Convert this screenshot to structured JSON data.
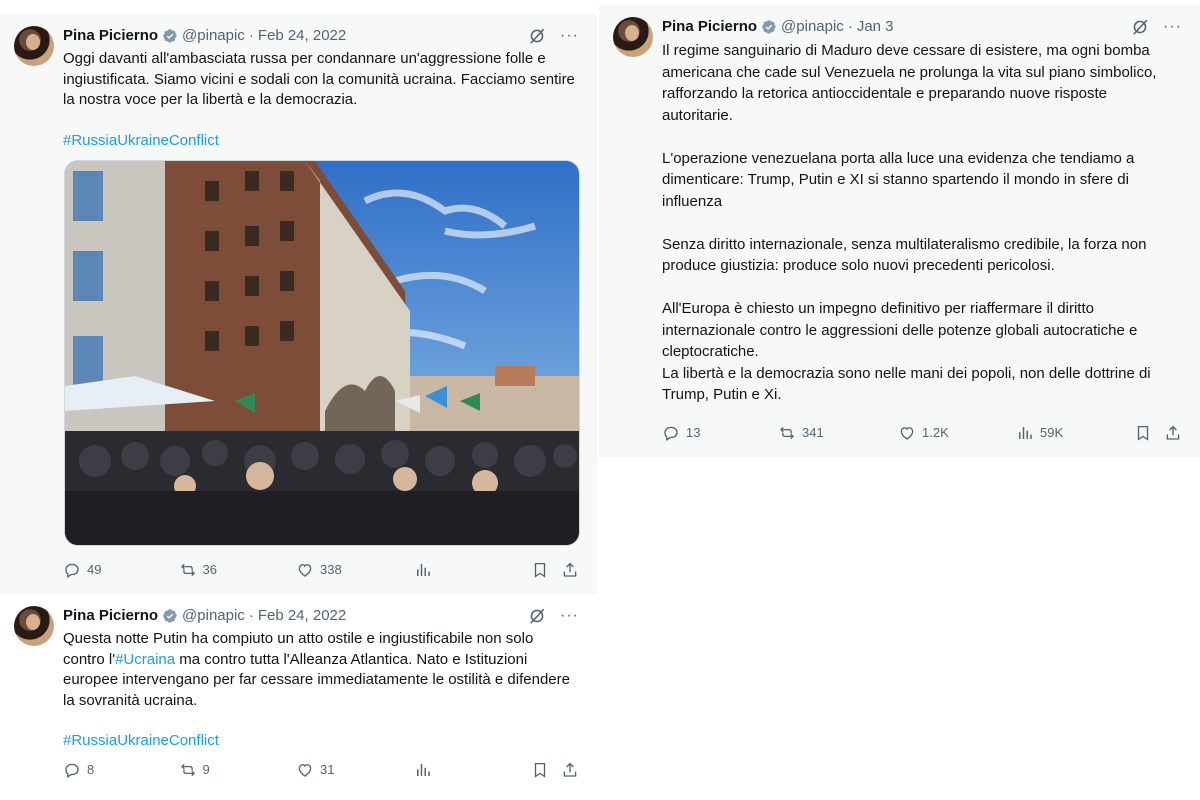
{
  "tweets": [
    {
      "name": "Pina Picierno",
      "handle": "@pinapic",
      "date": "Feb 24, 2022",
      "text": "Oggi davanti all'ambasciata russa per condannare un'aggressione folle e ingiustificata. Siamo vicini e sodali con la comunità ucraina. Facciamo sentire la nostra voce per la libertà e la democrazia.",
      "hashtag": "#RussiaUkraineConflict",
      "replies": "49",
      "reposts": "36",
      "likes": "338",
      "views": ""
    },
    {
      "name": "Pina Picierno",
      "handle": "@pinapic",
      "date": "Feb 24, 2022",
      "text_before": "Questa notte Putin ha compiuto un atto ostile e ingiustificabile non solo contro l'",
      "text_link": "#Ucraina",
      "text_after": " ma contro tutta l'Alleanza Atlantica. Nato e Istituzioni europee intervengano per far cessare immediatamente le ostilità e difendere la sovranità ucraina.",
      "hashtag": "#RussiaUkraineConflict",
      "replies": "8",
      "reposts": "9",
      "likes": "31",
      "views": ""
    },
    {
      "name": "Pina Picierno",
      "handle": "@pinapic",
      "date": "Jan 3",
      "text": "Il regime sanguinario di Maduro deve cessare di esistere, ma ogni bomba americana che cade sul Venezuela ne prolunga la vita sul piano simbolico, rafforzando la retorica antioccidentale e preparando nuove risposte autoritarie.\n\nL'operazione venezuelana porta alla luce una evidenza che tendiamo a dimenticare: Trump, Putin e XI si stanno spartendo il mondo in sfere di influenza\n\nSenza diritto internazionale, senza multilateralismo credibile, la forza non produce giustizia: produce solo nuovi precedenti pericolosi.\n\nAll'Europa è chiesto un impegno definitivo per riaffermare il diritto internazionale contro le aggressioni delle potenze globali autocratiche e cleptocratiche.\nLa libertà e la democrazia sono nelle mani dei popoli, non delle dottrine di Trump, Putin e Xi.",
      "replies": "13",
      "reposts": "341",
      "likes": "1.2K",
      "views": "59K"
    }
  ],
  "separator": "·",
  "more_icon": "···",
  "icons": [
    "verified-badge-icon",
    "grok-icon",
    "more-icon",
    "reply-icon",
    "repost-icon",
    "like-icon",
    "views-icon",
    "bookmark-icon",
    "share-icon"
  ],
  "colors": {
    "accent": "#1d9bf0",
    "text": "#0f1419",
    "muted": "#536471",
    "card_bg": "#f7f9f9"
  }
}
